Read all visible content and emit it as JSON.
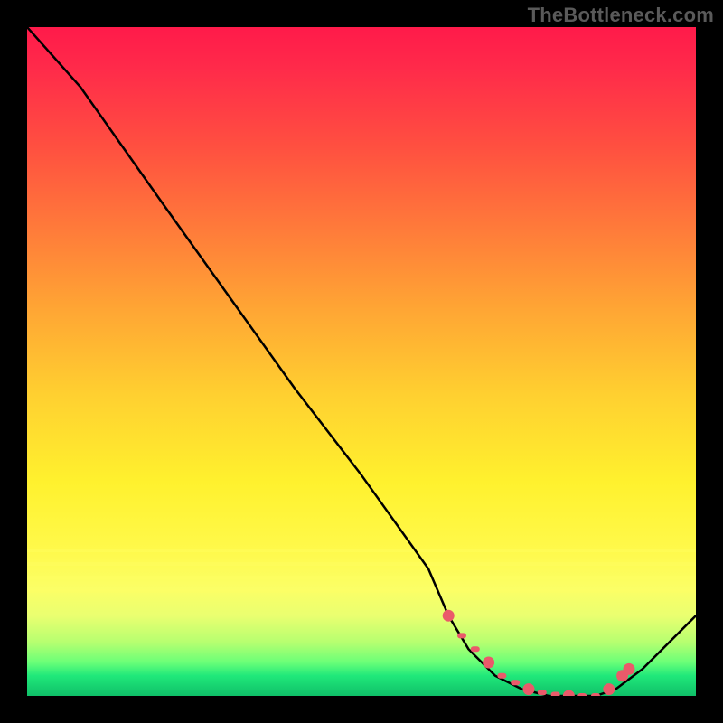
{
  "watermark": "TheBottleneck.com",
  "colors": {
    "bead": "#ea5a6a",
    "line": "#000000"
  },
  "chart_data": {
    "type": "line",
    "title": "",
    "xlabel": "",
    "ylabel": "",
    "xlim": [
      0,
      100
    ],
    "ylim": [
      0,
      100
    ],
    "grid": false,
    "legend": false,
    "series": [
      {
        "name": "curve",
        "x": [
          0,
          8,
          20,
          30,
          40,
          50,
          60,
          63,
          66,
          70,
          74,
          78,
          82,
          85,
          88,
          92,
          100
        ],
        "y": [
          100,
          91,
          74,
          60,
          46,
          33,
          19,
          12,
          7,
          3,
          1,
          0,
          0,
          0,
          1,
          4,
          12
        ]
      }
    ],
    "markers": {
      "name": "bottom-beads",
      "x": [
        63,
        65,
        67,
        69,
        71,
        73,
        75,
        77,
        79,
        81,
        83,
        85,
        87,
        89,
        90
      ],
      "y": [
        12,
        9,
        7,
        5,
        3,
        2,
        1,
        0.5,
        0.2,
        0,
        0,
        0,
        1,
        3,
        4
      ]
    }
  }
}
